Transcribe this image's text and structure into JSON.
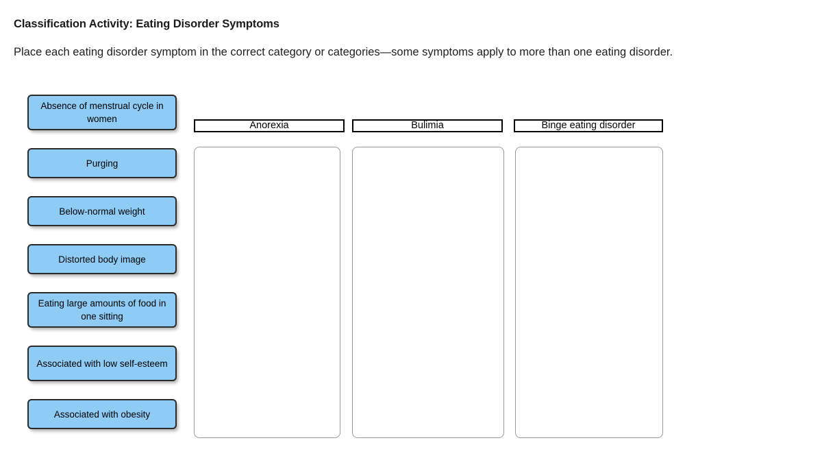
{
  "page": {
    "title": "Classification Activity: Eating Disorder Symptoms",
    "instructions": "Place each eating disorder symptom in the correct category or categories—some symptoms apply to more than one eating disorder."
  },
  "colors": {
    "tile_fill": "#8ecbf5",
    "tile_border": "#2b2b2b",
    "header_border": "#000000",
    "dropzone_border": "#9a9a9a",
    "background": "#ffffff",
    "text": "#000000"
  },
  "symptom_tiles": [
    {
      "label": "Absence of menstrual cycle in women",
      "lines": 2
    },
    {
      "label": "Purging",
      "lines": 1
    },
    {
      "label": "Below-normal weight",
      "lines": 1
    },
    {
      "label": "Distorted body image",
      "lines": 1
    },
    {
      "label": "Eating large amounts of food in one sitting",
      "lines": 2
    },
    {
      "label": "Associated with low self-esteem",
      "lines": 2
    },
    {
      "label": "Associated with obesity",
      "lines": 1
    }
  ],
  "categories": [
    {
      "label": "Anorexia",
      "dropped_items": []
    },
    {
      "label": "Bulimia",
      "dropped_items": []
    },
    {
      "label": "Binge eating disorder",
      "dropped_items": []
    }
  ]
}
